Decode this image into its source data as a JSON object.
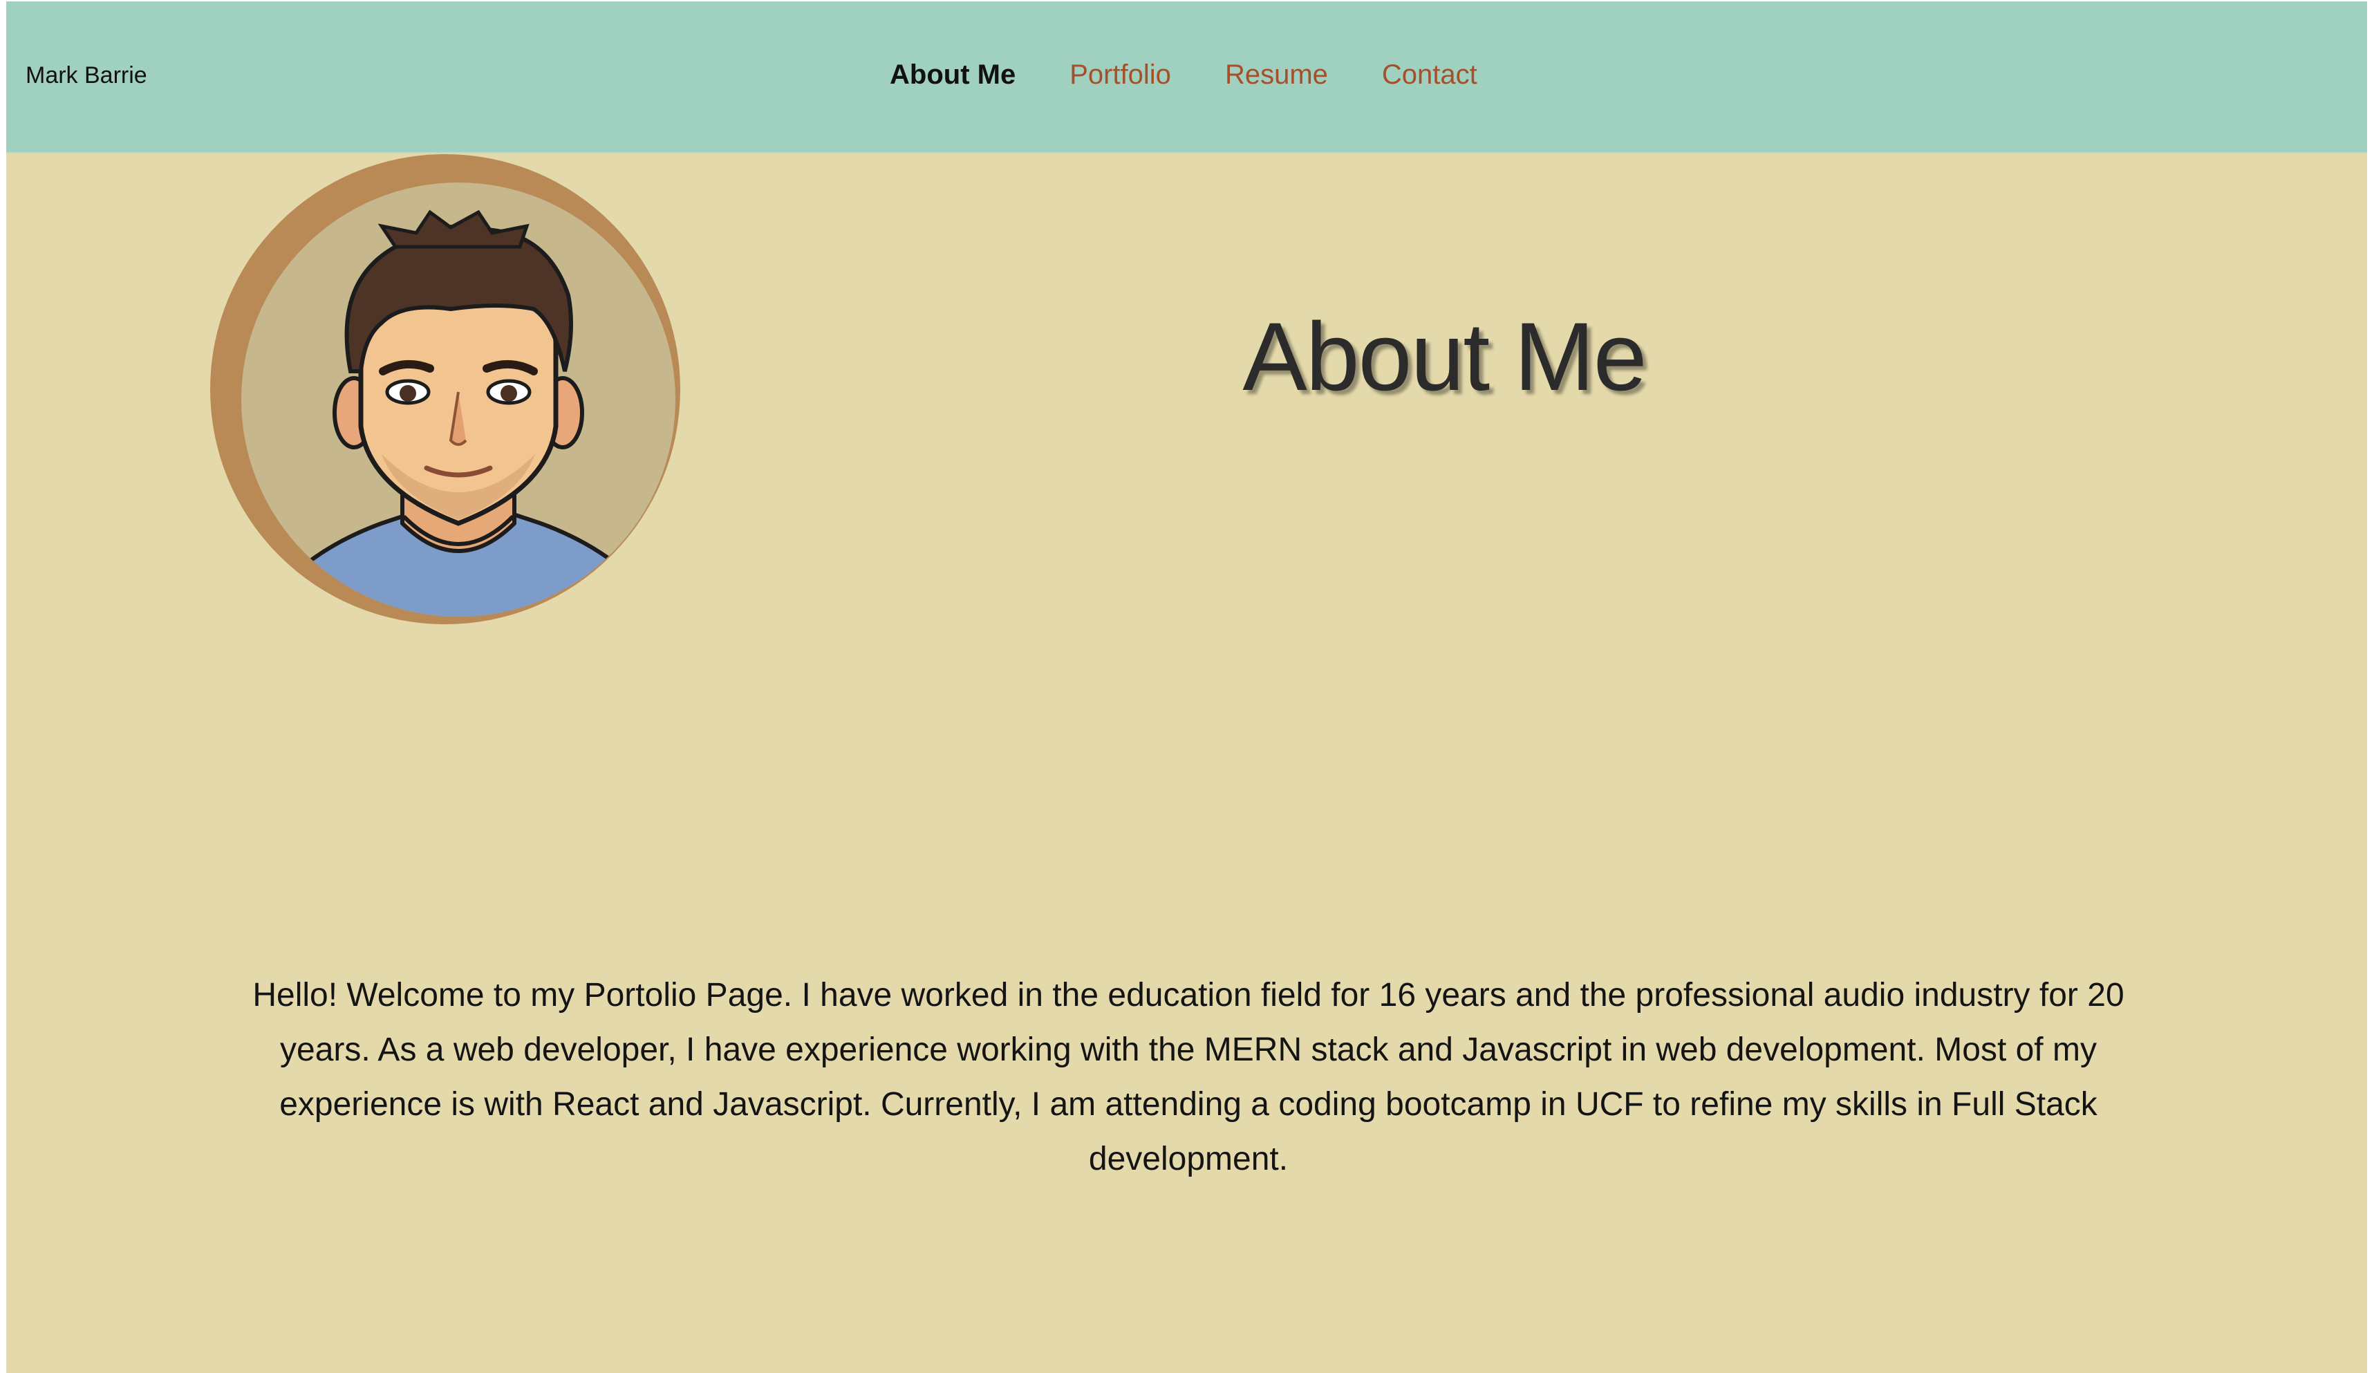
{
  "header": {
    "brand": "Mark Barrie",
    "nav": [
      {
        "label": "About Me",
        "active": true
      },
      {
        "label": "Portfolio",
        "active": false
      },
      {
        "label": "Resume",
        "active": false
      },
      {
        "label": "Contact",
        "active": false
      }
    ]
  },
  "main": {
    "avatar_icon": "cartoon-avatar-portrait",
    "title": "About Me",
    "bio": "Hello! Welcome to my Portolio Page. I have worked in the education field for 16 years and the professional audio industry for 20 years. As a web developer, I have experience working with the MERN stack and Javascript in web development. Most of my experience is with React and Javascript. Currently, I am attending a coding bootcamp in UCF to refine my skills in Full Stack development."
  },
  "colors": {
    "header_bg": "#a0d0c0",
    "page_bg": "#e4d9aa",
    "nav_link": "#a4502a",
    "nav_active": "#111111"
  }
}
